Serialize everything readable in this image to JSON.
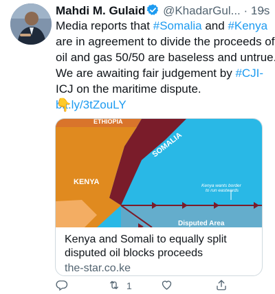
{
  "tweet": {
    "author_name": "Mahdi M. Gulaid",
    "handle": "@KhadarGul...",
    "dot": "·",
    "time": "19s",
    "more": "···",
    "body_lines": [
      [
        "Media reports that ",
        "#Somalia",
        " and ",
        "#Kenya"
      ],
      [
        "are in agreement to divide the proceeds of"
      ],
      [
        "oil and gas 50/50 are baseless and untrue."
      ],
      [
        "We are awaiting fair judgement by ",
        "#CJI-"
      ],
      [
        "ICJ on the maritime dispute."
      ],
      [
        "bit.ly/3tZouLY"
      ]
    ],
    "emoji": "👇",
    "icons": {
      "verified": "verified-badge-icon",
      "accent": "#1d9bf0"
    }
  },
  "card": {
    "map_labels": {
      "ethiopia": "ETHIOPIA",
      "somalia": "SOMALIA",
      "kenya": "KENYA",
      "annotation_line1": "Kenya wants border",
      "annotation_line2": "to run eastwards",
      "disputed": "Disputed Area"
    },
    "title_line1": "Kenya and Somali to equally split",
    "title_line2": "disputed oil blocks proceeds",
    "domain": "the-star.co.ke"
  },
  "actions": {
    "reply_icon": "reply-icon",
    "retweet_icon": "retweet-icon",
    "retweet_count": "1",
    "like_icon": "heart-icon",
    "share_icon": "share-icon"
  }
}
